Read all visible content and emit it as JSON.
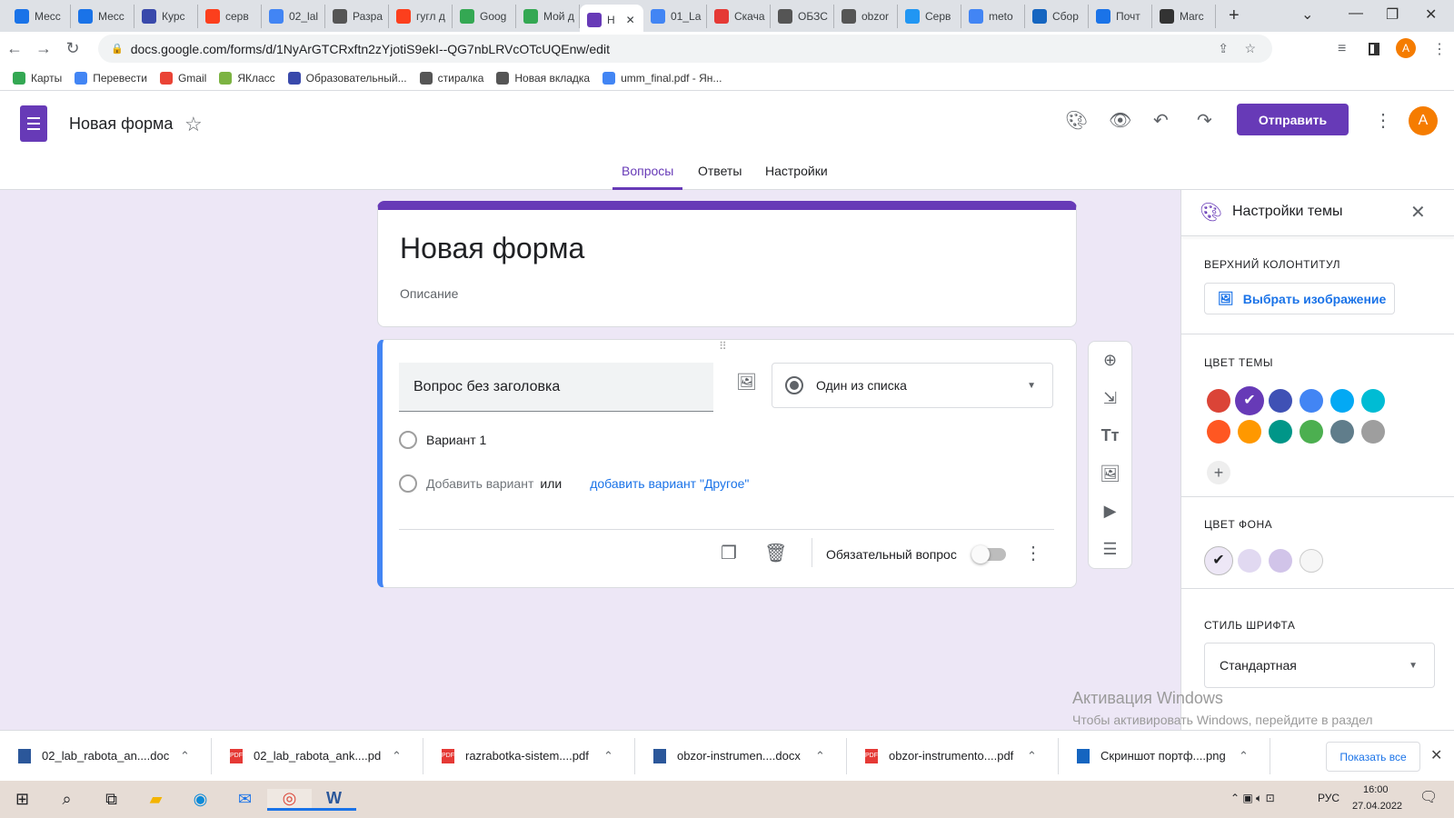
{
  "browser": {
    "tabs": [
      {
        "label": "Месс"
      },
      {
        "label": "Месс"
      },
      {
        "label": "Курс"
      },
      {
        "label": "серв"
      },
      {
        "label": "02_lal"
      },
      {
        "label": "Разра"
      },
      {
        "label": "гугл д"
      },
      {
        "label": "Goog"
      },
      {
        "label": "Мой д"
      },
      {
        "label": "Н",
        "active": true
      },
      {
        "label": "01_La"
      },
      {
        "label": "Скача"
      },
      {
        "label": "ОБЗС"
      },
      {
        "label": "obzor"
      },
      {
        "label": "Серв"
      },
      {
        "label": "meto"
      },
      {
        "label": "Сбор"
      },
      {
        "label": "Почт"
      },
      {
        "label": "Marc"
      }
    ],
    "new_tab": "+",
    "url": "docs.google.com/forms/d/1NyArGTCRxftn2zYjotiS9ekI--QG7nbLRVcOTcUQEnw/edit",
    "profile": "A",
    "bookmarks": [
      "Карты",
      "Перевести",
      "Gmail",
      "ЯКласс",
      "Образовательный...",
      "стиралка",
      "Новая вкладка",
      "umm_final.pdf - Ян..."
    ]
  },
  "header": {
    "doc_title": "Новая форма",
    "send_label": "Отправить",
    "avatar": "A",
    "tabs": [
      {
        "label": "Вопросы",
        "active": true
      },
      {
        "label": "Ответы"
      },
      {
        "label": "Настройки"
      }
    ]
  },
  "form": {
    "title": "Новая форма",
    "description": "Описание",
    "question": {
      "title": "Вопрос без заголовка",
      "type": "Один из списка",
      "option1": "Вариант 1",
      "add_option": "Добавить вариант",
      "or": "или",
      "add_other": "добавить вариант \"Другое\"",
      "required_label": "Обязательный вопрос",
      "required": false
    }
  },
  "theme_panel": {
    "title": "Настройки темы",
    "header_label": "ВЕРХНИЙ КОЛОНТИТУЛ",
    "choose_image": "Выбрать изображение",
    "theme_color_label": "ЦВЕТ ТЕМЫ",
    "theme_colors": [
      "#db4437",
      "#673ab7",
      "#3f51b5",
      "#4285f4",
      "#03a9f4",
      "#00bcd4",
      "#ff5722",
      "#ff9800",
      "#009688",
      "#4caf50",
      "#607d8b",
      "#9e9e9e"
    ],
    "selected_theme_color": "#673ab7",
    "bg_color_label": "ЦВЕТ ФОНА",
    "bg_colors": [
      "#ede7f6",
      "#e1d9f1",
      "#d1c4e9",
      "#f6f6f6"
    ],
    "selected_bg_color": "#ede7f6",
    "font_label": "СТИЛЬ ШРИФТА",
    "font_value": "Стандартная"
  },
  "watermark": {
    "title": "Активация Windows",
    "text": "Чтобы активировать Windows, перейдите в раздел \"Параметры\"."
  },
  "downloads": {
    "items": [
      {
        "name": "02_lab_rabota_an....docx",
        "type": "docx"
      },
      {
        "name": "02_lab_rabota_ank....pdf",
        "type": "pdf"
      },
      {
        "name": "razrabotka-sistem....pdf",
        "type": "pdf"
      },
      {
        "name": "obzor-instrumen....docx",
        "type": "docx"
      },
      {
        "name": "obzor-instrumento....pdf",
        "type": "pdf"
      },
      {
        "name": "Скриншот портф....png",
        "type": "png"
      }
    ],
    "show_all": "Показать все"
  },
  "taskbar": {
    "lang": "РУС",
    "time": "16:00",
    "date": "27.04.2022",
    "notifications": "1"
  }
}
